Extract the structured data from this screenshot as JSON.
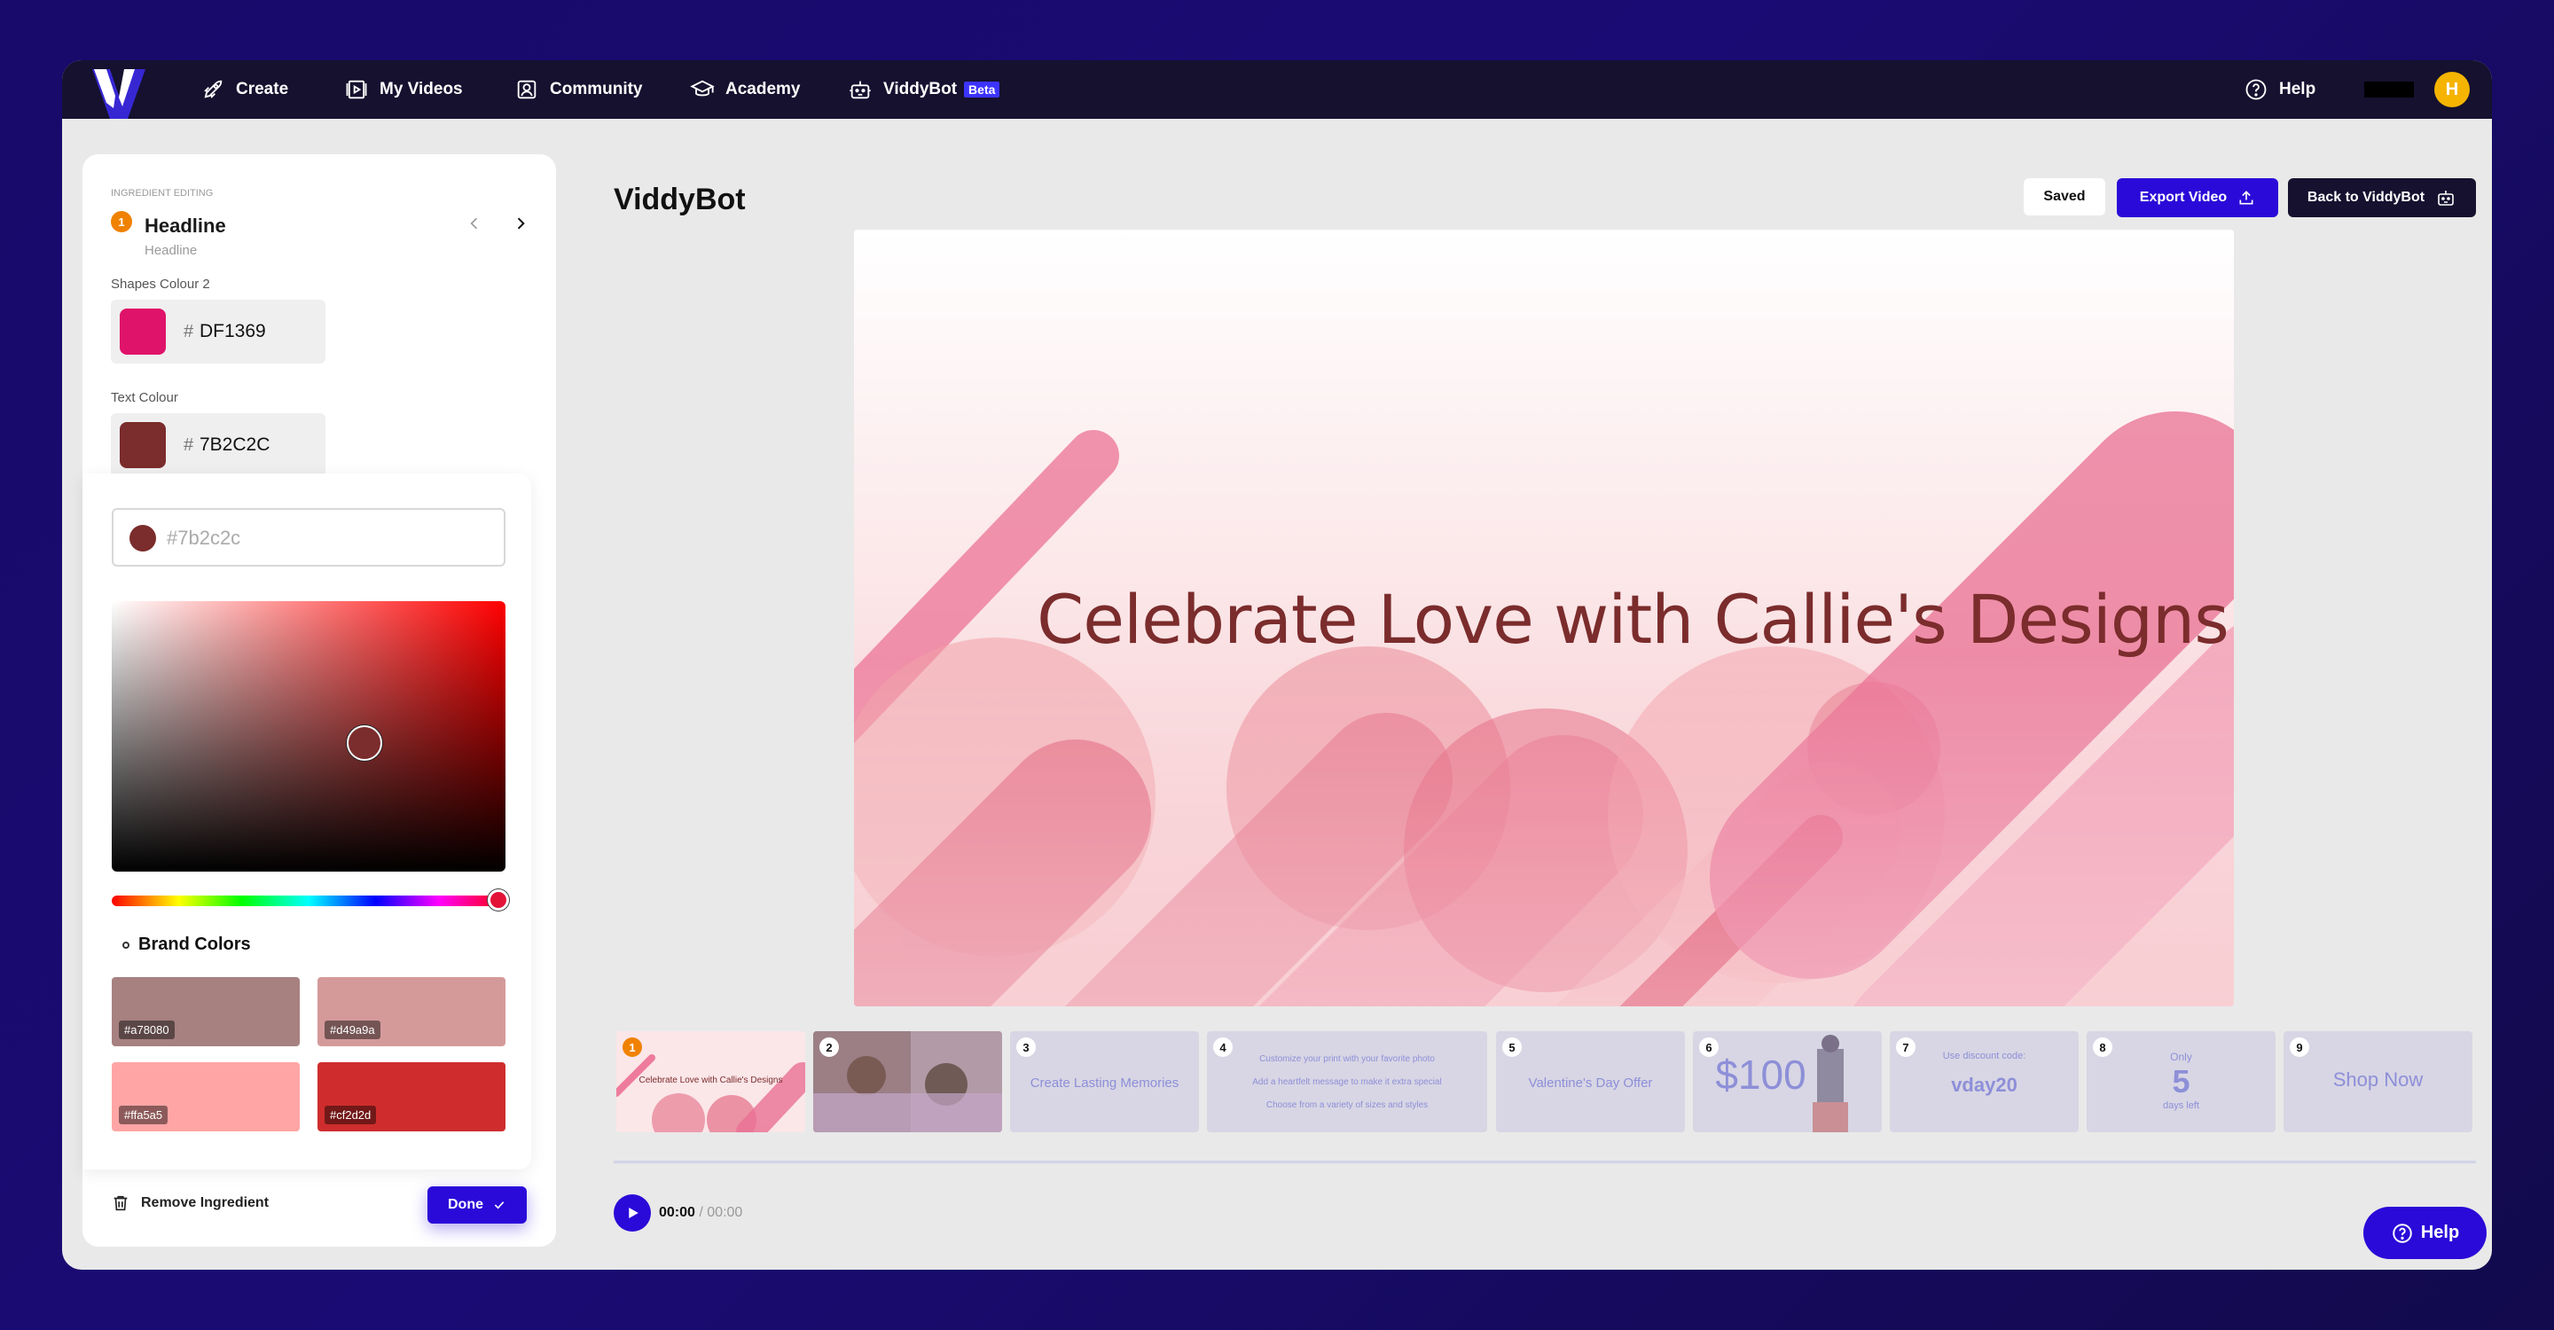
{
  "nav": {
    "items": [
      {
        "label": "Create",
        "icon": "rocket-icon"
      },
      {
        "label": "My Videos",
        "icon": "video-icon"
      },
      {
        "label": "Community",
        "icon": "community-icon"
      },
      {
        "label": "Academy",
        "icon": "graduation-cap-icon"
      },
      {
        "label": "ViddyBot",
        "icon": "robot-icon",
        "badge": "Beta"
      }
    ],
    "help_label": "Help",
    "avatar_initial": "H"
  },
  "panel": {
    "section_label": "INGREDIENT EDITING",
    "ingredient_number": "1",
    "ingredient_title": "Headline",
    "ingredient_subtitle": "Headline",
    "shapes_colour_label": "Shapes Colour 2",
    "shapes_colour_hex": "DF1369",
    "shapes_colour": "#DF1369",
    "text_colour_label": "Text Colour",
    "text_colour_hex": "7B2C2C",
    "text_colour": "#7B2C2C",
    "hash": "#",
    "picker_input_placeholder": "#7b2c2c",
    "brand_colors_title": "Brand Colors",
    "brand_colors": [
      {
        "label": "#a78080",
        "color": "#a78080"
      },
      {
        "label": "#d49a9a",
        "color": "#d49a9a"
      },
      {
        "label": "#ffa5a5",
        "color": "#ffa5a5"
      },
      {
        "label": "#cf2d2d",
        "color": "#cf2d2d"
      }
    ],
    "remove_label": "Remove Ingredient",
    "done_label": "Done"
  },
  "main": {
    "title": "ViddyBot",
    "saved_label": "Saved",
    "export_label": "Export Video",
    "back_label": "Back to ViddyBot",
    "headline_text": "Celebrate Love with Callie's Designs",
    "time_current": "00:00",
    "time_total": "/ 00:00",
    "help_label": "Help"
  },
  "thumbnails": [
    {
      "n": "1",
      "text": "Celebrate Love with Callie's Designs"
    },
    {
      "n": "2",
      "text": ""
    },
    {
      "n": "3",
      "text": "Create Lasting Memories"
    },
    {
      "n": "4",
      "text": "Customize your print with your favorite photo",
      "text2": "Add a heartfelt message to make it extra special",
      "text3": "Choose from a variety of sizes and styles"
    },
    {
      "n": "5",
      "text": "Valentine's Day Offer"
    },
    {
      "n": "6",
      "text": "$100"
    },
    {
      "n": "7",
      "text": "Use discount code:",
      "text2": "vday20"
    },
    {
      "n": "8",
      "text": "Only",
      "text2": "5",
      "text3": "days left"
    },
    {
      "n": "9",
      "text": "Shop Now"
    }
  ]
}
